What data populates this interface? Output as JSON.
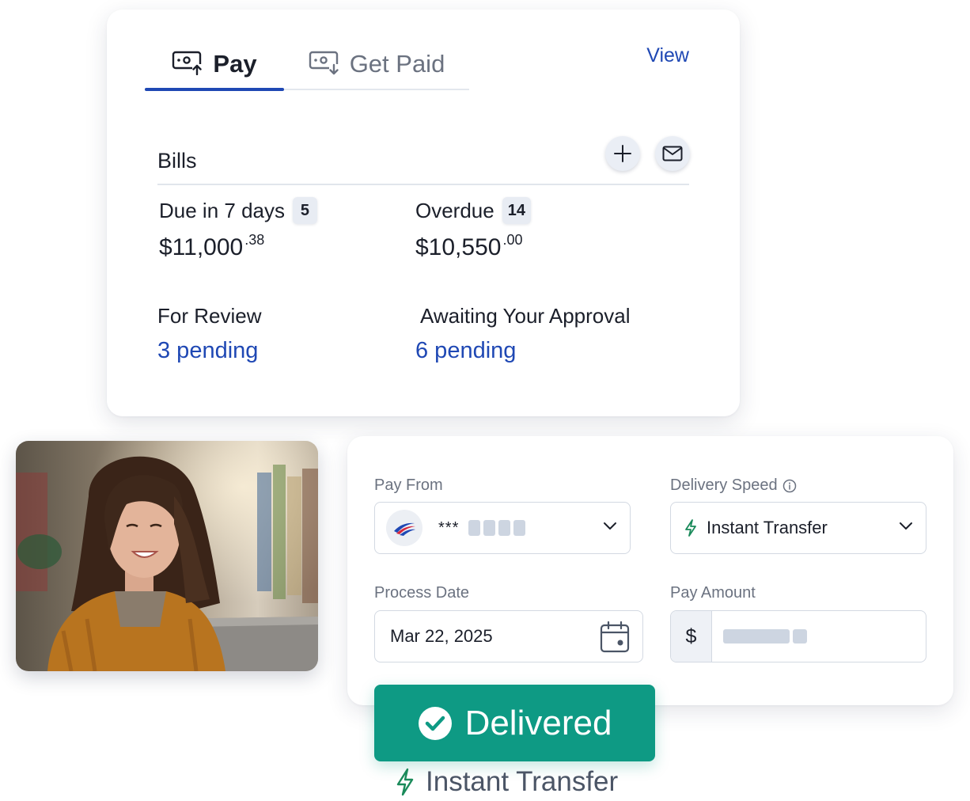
{
  "bills_card": {
    "tabs": [
      {
        "label": "Pay",
        "icon": "pay-icon",
        "active": true
      },
      {
        "label": "Get Paid",
        "icon": "get-paid-icon",
        "active": false
      }
    ],
    "view_label": "View",
    "section_title": "Bills",
    "due_soon": {
      "label": "Due in 7 days",
      "count": "5",
      "amount_main": "$11,000",
      "amount_cents": ".38"
    },
    "overdue": {
      "label": "Overdue",
      "count": "14",
      "amount_main": "$10,550",
      "amount_cents": ".00"
    },
    "for_review": {
      "label": "For Review",
      "pending": "3 pending"
    },
    "awaiting_approval": {
      "label": "Awaiting Your Approval",
      "pending": "6 pending"
    }
  },
  "form": {
    "pay_from": {
      "label": "Pay From",
      "masked_prefix": "***"
    },
    "delivery_speed": {
      "label": "Delivery Speed",
      "value": "Instant Transfer"
    },
    "process_date": {
      "label": "Process Date",
      "value": "Mar 22, 2025"
    },
    "pay_amount": {
      "label": "Pay Amount",
      "currency": "$"
    }
  },
  "status": {
    "label": "Delivered",
    "footer_label": "Instant Transfer"
  },
  "colors": {
    "accent": "#1f48b4",
    "success": "#0e9a84",
    "instant_icon": "#1a8a5a"
  }
}
